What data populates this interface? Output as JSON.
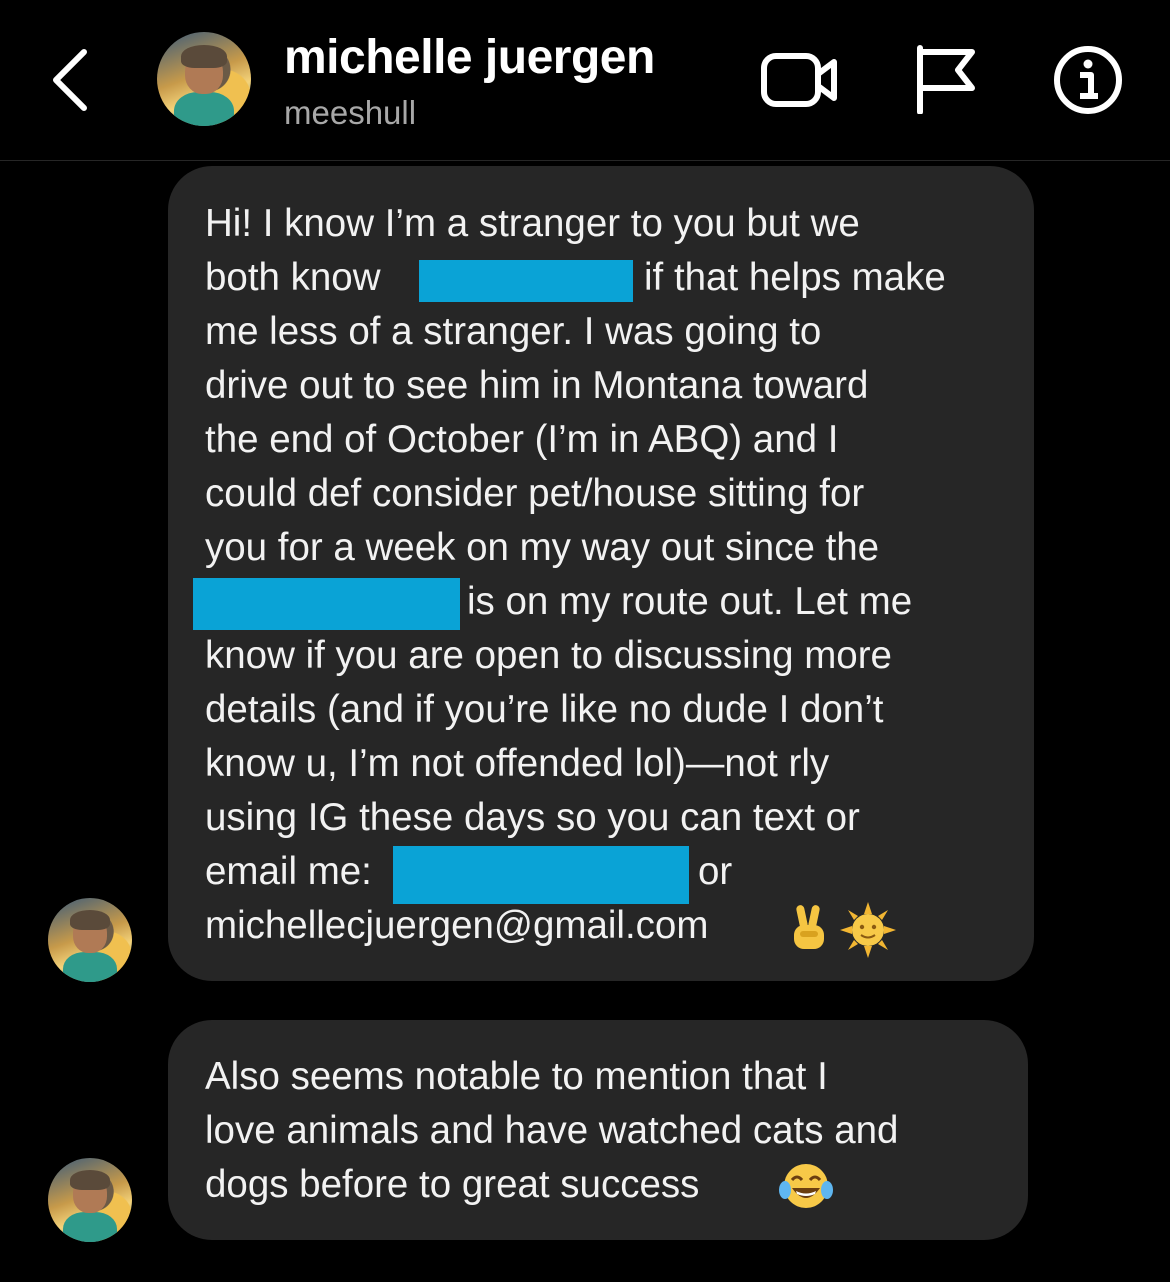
{
  "header": {
    "name": "michelle juergen",
    "username": "meeshull",
    "icons": [
      "back-chevron-icon",
      "video-call-icon",
      "flag-icon",
      "info-icon"
    ]
  },
  "message1": {
    "lines": [
      "Hi! I know I’m a stranger to you but we",
      "both know",
      "if that helps make",
      "me less of a stranger. I was going to",
      "drive out to see him in Montana toward",
      "the end of October (I’m in ABQ) and I",
      "could def consider pet/house sitting for",
      "you for a week on my way out since the",
      "is on my route out. Let me",
      "know if you are open to discussing more",
      "details (and if you’re like no dude I don’t",
      "know u, I’m not offended lol)—not rly",
      "using IG these days so you can text or",
      "email me:",
      "or",
      "michellecjuergen@gmail.com"
    ],
    "emojis": [
      "victory-hand-emoji",
      "sun-with-face-emoji"
    ]
  },
  "message2": {
    "lines": [
      "Also seems notable to mention that I",
      "love animals and have watched cats and",
      "dogs before to great success"
    ],
    "emojis": [
      "tears-of-joy-emoji"
    ]
  },
  "colors": {
    "background": "#000000",
    "bubble": "#262626",
    "redaction": "#0aa3d6",
    "secondary_text": "#a8a8a8"
  }
}
